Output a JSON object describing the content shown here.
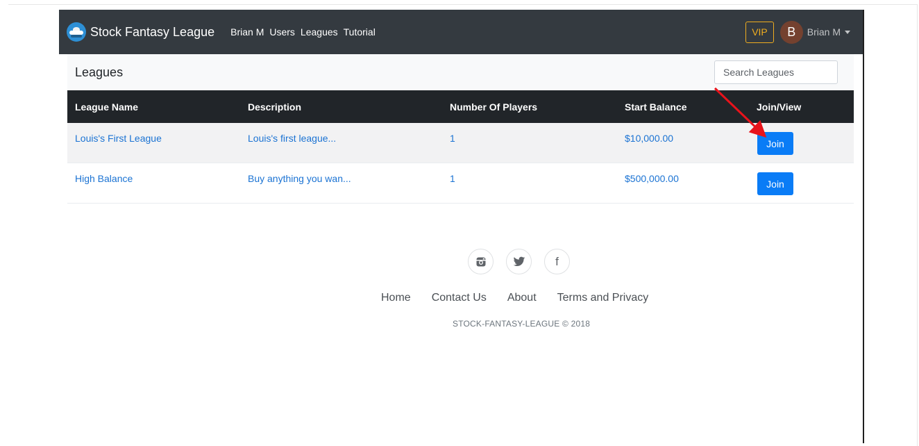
{
  "navbar": {
    "brand": "Stock Fantasy League",
    "links": [
      "Brian M",
      "Users",
      "Leagues",
      "Tutorial"
    ],
    "vip_label": "VIP",
    "avatar_initial": "B",
    "user_name": "Brian M",
    "logo_icon": "stock-fantasy-logo-icon"
  },
  "page": {
    "title": "Leagues",
    "search_placeholder": "Search Leagues"
  },
  "table": {
    "columns": [
      "League Name",
      "Description",
      "Number Of Players",
      "Start Balance",
      "Join/View"
    ],
    "rows": [
      {
        "name": "Louis's First League",
        "description": "Louis's first league...",
        "players": "1",
        "balance": "$10,000.00",
        "action": "Join"
      },
      {
        "name": "High Balance",
        "description": "Buy anything you wan...",
        "players": "1",
        "balance": "$500,000.00",
        "action": "Join"
      }
    ]
  },
  "footer": {
    "social_icons": [
      "instagram-icon",
      "twitter-icon",
      "facebook-icon"
    ],
    "social_glyphs": [
      "◙",
      "🐦",
      "f"
    ],
    "links": [
      "Home",
      "Contact Us",
      "About",
      "Terms and Privacy"
    ],
    "copyright": "STOCK-FANTASY-LEAGUE © 2018"
  },
  "colors": {
    "navbar": "#343a40",
    "vip": "#f0ad1f",
    "avatar": "#74412f",
    "link": "#1b73d3",
    "button": "#0a7cf6",
    "annotation_arrow": "#e8131b"
  }
}
